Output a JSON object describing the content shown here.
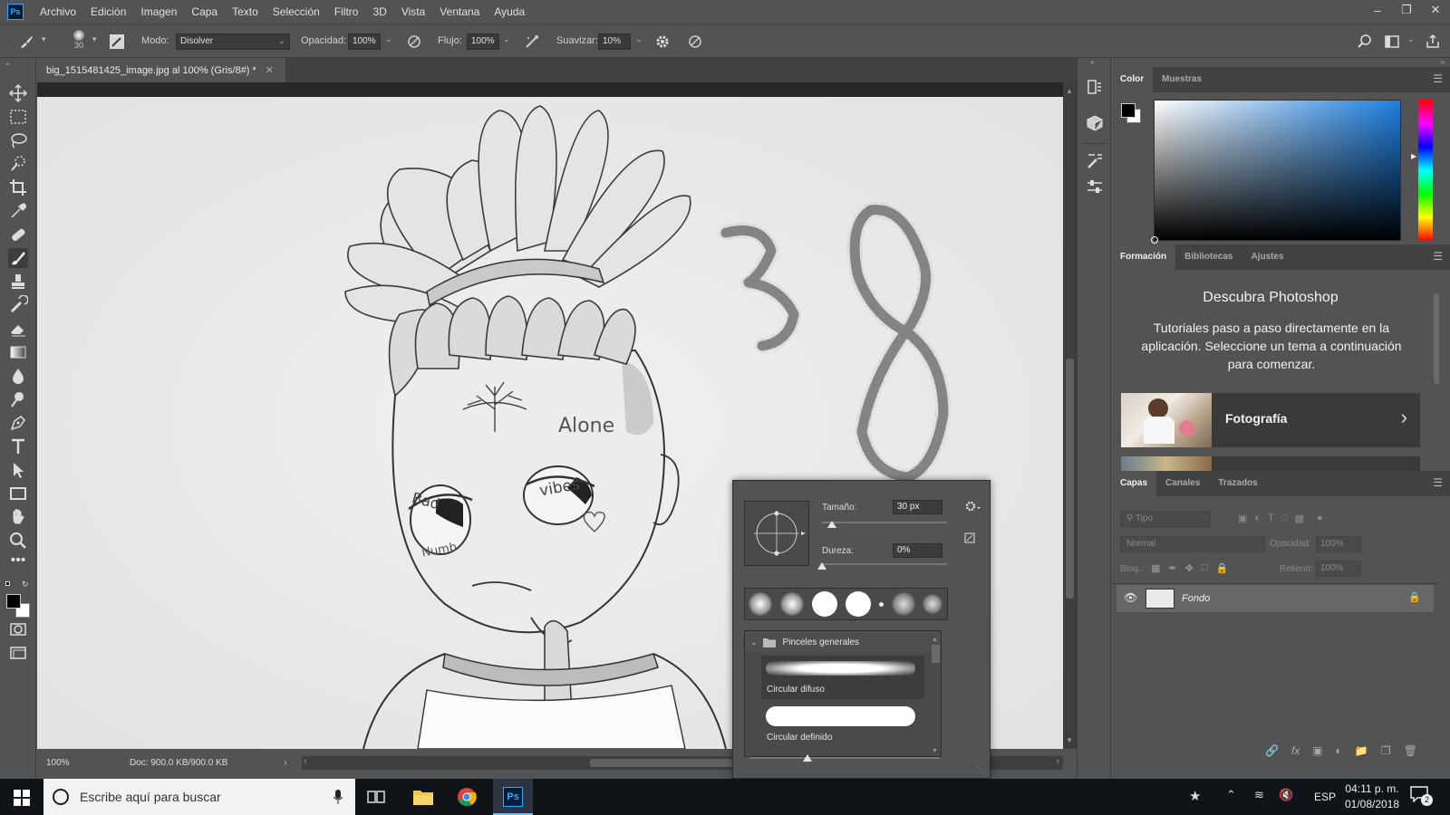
{
  "app": {
    "logo": "Ps"
  },
  "menu": [
    "Archivo",
    "Edición",
    "Imagen",
    "Capa",
    "Texto",
    "Selección",
    "Filtro",
    "3D",
    "Vista",
    "Ventana",
    "Ayuda"
  ],
  "options": {
    "brush_size": "30",
    "mode_label": "Modo:",
    "mode_value": "Disolver",
    "opacity_label": "Opacidad:",
    "opacity_value": "100%",
    "flow_label": "Flujo:",
    "flow_value": "100%",
    "smooth_label": "Suavizar:",
    "smooth_value": "10%"
  },
  "document": {
    "tab_title": "big_1515481425_image.jpg al 100% (Gris/8#) *",
    "zoom": "100%",
    "doc_info": "Doc: 900.0 KB/900.0 KB",
    "drawing_texts": {
      "alone": "Alone",
      "vibes": "vibes",
      "bad": "Bad",
      "numb": "Numb",
      "number": "38"
    }
  },
  "brush_popup": {
    "size_label": "Tamaño:",
    "size_value": "30 px",
    "size_level": 0.08,
    "hardness_label": "Dureza:",
    "hardness_value": "0%",
    "hardness_level": 0,
    "folder_name": "Pinceles generales",
    "brushes": [
      "Circular difuso",
      "Circular definido"
    ]
  },
  "color_panel": {
    "tabs": [
      "Color",
      "Muestras"
    ],
    "foreground": "#000000",
    "background": "#ffffff"
  },
  "learn_panel": {
    "tabs": [
      "Formación",
      "Bibliotecas",
      "Ajustes"
    ],
    "title": "Descubra Photoshop",
    "description": "Tutoriales paso a paso directamente en la aplicación. Seleccione un tema a continuación para comenzar.",
    "topic": "Fotografía"
  },
  "layers_panel": {
    "tabs": [
      "Capas",
      "Canales",
      "Trazados"
    ],
    "filter_placeholder": "Tipo",
    "blend_mode": "Normal",
    "opacity_label": "Opacidad:",
    "opacity_value": "100%",
    "lock_label": "Bloq.:",
    "fill_label": "Relleno:",
    "fill_value": "100%",
    "layers": [
      {
        "name": "Fondo",
        "visible": true,
        "locked": true
      }
    ],
    "footer_icons": [
      "link-icon",
      "fx-icon",
      "mask-icon",
      "adjustment-icon",
      "group-icon",
      "new-layer-icon",
      "trash-icon"
    ]
  },
  "taskbar": {
    "search_placeholder": "Escribe aquí para buscar",
    "language": "ESP",
    "time": "04:11 p. m.",
    "date": "01/08/2018",
    "notifications": "2"
  },
  "colors": {
    "ui_bg": "#535353",
    "canvas_bg": "#ededed",
    "accent_blue": "#31a8ff",
    "taskbar_bg": "#101318"
  }
}
